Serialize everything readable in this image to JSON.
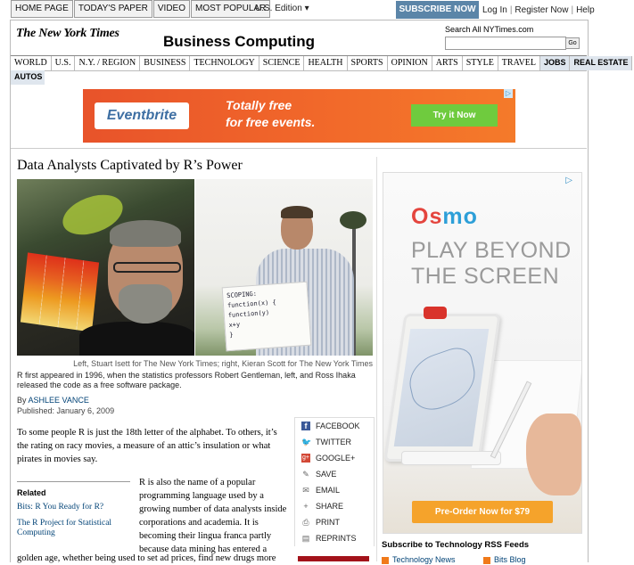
{
  "topnav": {
    "items": [
      "HOME PAGE",
      "TODAY'S PAPER",
      "VIDEO",
      "MOST POPULAR"
    ],
    "edition": "U.S. Edition",
    "subscribe": "SUBSCRIBE NOW",
    "login": "Log In",
    "register": "Register Now",
    "help": "Help"
  },
  "masthead": {
    "logo": "The New York Times",
    "section_title": "Business Computing",
    "search_label": "Search All NYTimes.com",
    "search_value": "",
    "go_label": "Go"
  },
  "sections": [
    "WORLD",
    "U.S.",
    "N.Y. / REGION",
    "BUSINESS",
    "TECHNOLOGY",
    "SCIENCE",
    "HEALTH",
    "SPORTS",
    "OPINION",
    "ARTS",
    "STYLE",
    "TRAVEL"
  ],
  "sections_alt": [
    "JOBS",
    "REAL ESTATE"
  ],
  "autos": "AUTOS",
  "banner_ad": {
    "logo": "Eventbrite",
    "line1": "Totally free",
    "line2": "for free events.",
    "button": "Try it Now",
    "adchoices": "▷"
  },
  "article": {
    "headline": "Data Analysts Captivated by R’s Power",
    "photo_sign": [
      "SCOPING:",
      "function(x) {",
      "  function(y)",
      "    x+y",
      "}"
    ],
    "photo_credit": "Left, Stuart Isett for The New York Times; right, Kieran Scott for The New York Times",
    "caption": "R first appeared in 1996, when the statistics professors Robert Gentleman, left, and Ross Ihaka released the code as a free software package.",
    "byline_prefix": "By",
    "author": "ASHLEE VANCE",
    "published": "Published: January 6, 2009",
    "para1": "To some people R is just the 18th letter of the alphabet. To others, it’s the rating on racy movies, a measure of an attic’s insulation or what pirates in movies say.",
    "para2": "R is also the name of a popular programming language used by a growing number of data analysts inside corporations and academia. It is becoming their lingua franca partly because data mining has entered a",
    "para3": "golden age, whether being used to set ad prices, find new drugs more"
  },
  "related": {
    "heading": "Related",
    "links": [
      "Bits: R You Ready for R?",
      "The R Project for Statistical Computing"
    ]
  },
  "tools": [
    {
      "icon": "facebook-icon",
      "glyph": "f",
      "label": "FACEBOOK"
    },
    {
      "icon": "twitter-icon",
      "glyph": "🐦",
      "label": "TWITTER"
    },
    {
      "icon": "google-plus-icon",
      "glyph": "g+",
      "label": "GOOGLE+"
    },
    {
      "icon": "save-icon",
      "glyph": "✎",
      "label": "SAVE"
    },
    {
      "icon": "email-icon",
      "glyph": "✉",
      "label": "EMAIL"
    },
    {
      "icon": "share-icon",
      "glyph": "+",
      "label": "SHARE"
    },
    {
      "icon": "print-icon",
      "glyph": "⎙",
      "label": "PRINT"
    },
    {
      "icon": "reprints-icon",
      "glyph": "▤",
      "label": "REPRINTS"
    }
  ],
  "side_ad": {
    "brand_o": "Os",
    "brand_rest": "mo",
    "tagline1": "PLAY BEYOND",
    "tagline2": "THE SCREEN",
    "button": "Pre-Order Now for $79",
    "adchoices": "▷"
  },
  "rss": {
    "title": "Subscribe to Technology RSS Feeds",
    "feed1": "Technology News",
    "feed2": "Bits Blog"
  },
  "colors": {
    "link": "#004276",
    "subscribe_bg": "#5b85a8",
    "eventbrite_orange": "#f26a2a",
    "eventbrite_button": "#6fcb3e",
    "osmo_button": "#f5a32b"
  }
}
